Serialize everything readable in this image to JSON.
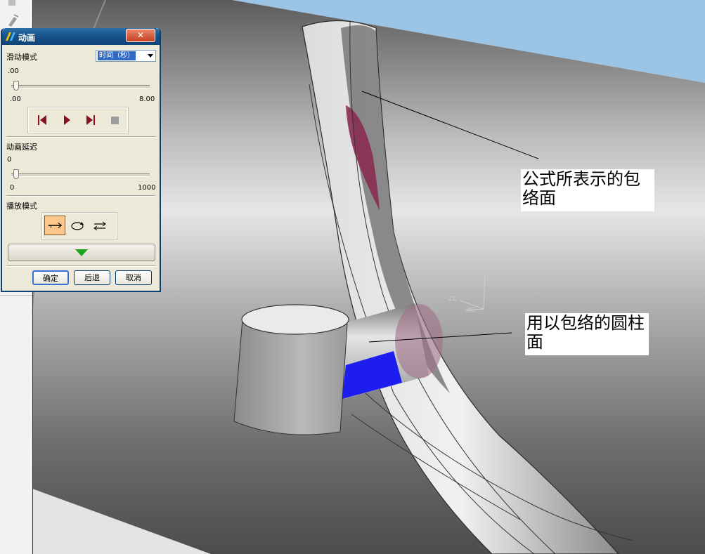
{
  "dialog": {
    "title": "动画",
    "close_symbol": "✕",
    "slide_mode": {
      "label": "滑动模式",
      "selected": "时间（秒）",
      "current_value": ".00",
      "range_min": ".00",
      "range_max": "8.00",
      "position": 0.0
    },
    "playback_controls": [
      "step-back-icon",
      "play-icon",
      "step-forward-icon",
      "stop-icon"
    ],
    "animation_delay": {
      "label": "动画延迟",
      "current_value": "0",
      "range_min": "0",
      "range_max": "1000",
      "position": 0.0
    },
    "play_mode": {
      "label": "播放模式",
      "options": [
        "play-once-icon",
        "loop-icon",
        "bounce-icon"
      ],
      "selected_index": 0
    },
    "buttons": {
      "ok": "确定",
      "back": "后退",
      "cancel": "取消"
    }
  },
  "annotations": {
    "envelope_surface": "公式所表示的包络面",
    "cylinder_surface": "用以包络的圆柱面"
  },
  "csys_labels": {
    "zc": "ZC",
    "xc": "XC"
  },
  "colors": {
    "titlebar": "#164e86",
    "dialog_bg": "#ece9d8",
    "sky": "#9cc4e4",
    "surface_highlight": "#8a2c52",
    "cylinder_face": "#1d1df0"
  }
}
